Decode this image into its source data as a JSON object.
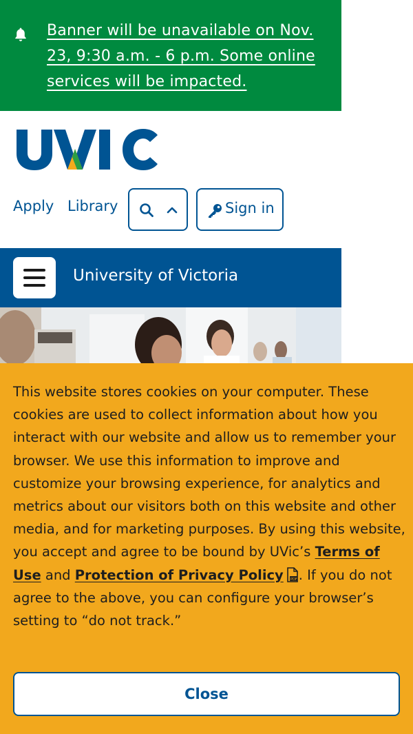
{
  "alert": {
    "icon": "bell-icon",
    "text": "Banner will be unavailable on Nov. 23, 9:30 a.m. - 6 p.m. Some online services will be impacted.",
    "background": "#008a3f"
  },
  "header": {
    "logo_text": "UVIC",
    "nav": {
      "apply": "Apply",
      "library": "Library",
      "search_icon": "search-icon",
      "chevron_icon": "chevron-up-icon",
      "sign_in": "Sign in",
      "sign_in_icon": "key-icon"
    }
  },
  "site_bar": {
    "menu_icon": "hamburger-menu-icon",
    "title": "University of Victoria",
    "background": "#005493"
  },
  "cookie": {
    "text_before": "This website stores cookies on your computer. These cookies are used to collect information about how you interact with our website and allow us to remember your browser. We use this information to improve and customize your browsing experience, for analytics and metrics about our visitors both on this website and other media, and for marketing purposes. By using this website, you accept and agree to be bound by UVic’s ",
    "terms_link": "Terms of Use",
    "and": " and ",
    "privacy_link": "Protection of Privacy Policy",
    "pdf_icon": "pdf-file-icon",
    "text_after": ". If you do not agree to the above, you can configure your browser’s setting to “do not track.”",
    "close_label": "Close",
    "background": "#f2a81d"
  }
}
